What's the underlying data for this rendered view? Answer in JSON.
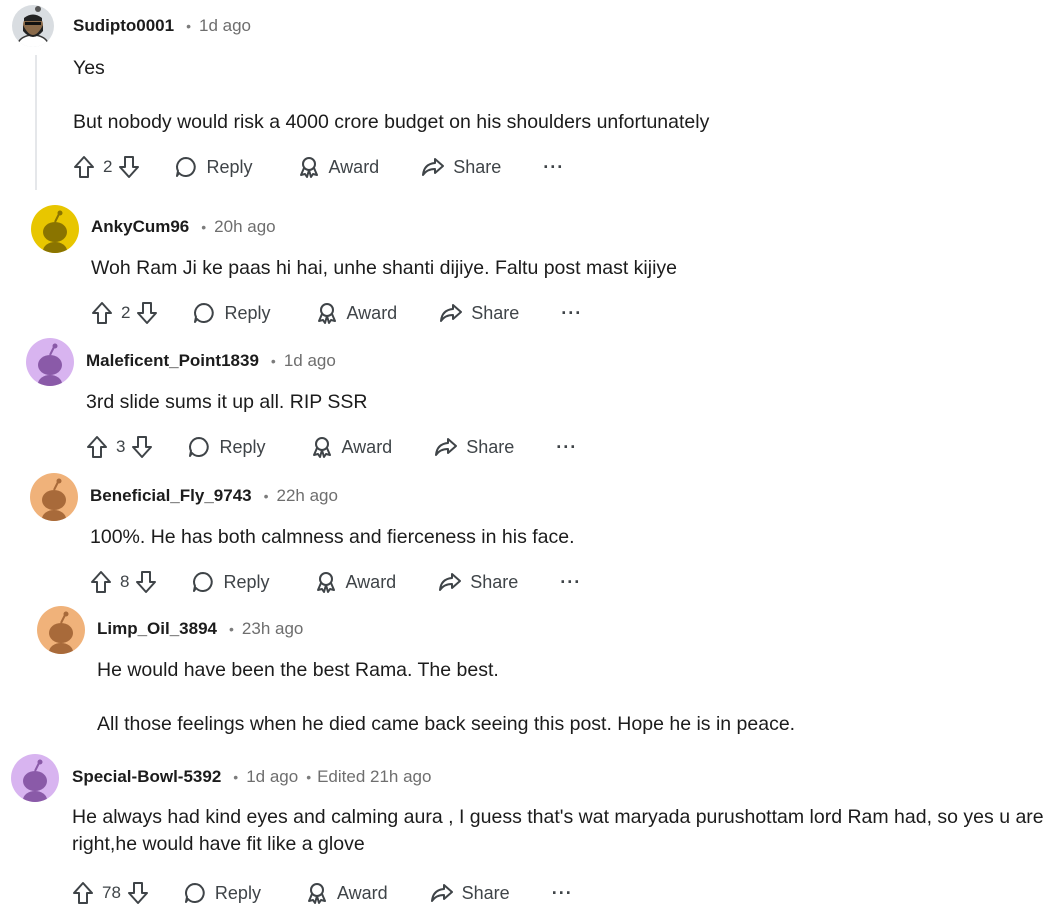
{
  "comments": [
    {
      "author": "Sudipto0001",
      "time": "1d ago",
      "body": [
        "Yes",
        "But nobody would risk a 4000 crore budget on his shoulders unfortunately"
      ],
      "votes": "2",
      "avatar_color": "#d9dde1",
      "avatar_icon": "bearded-man-avatar"
    },
    {
      "author": "AnkyCum96",
      "time": "20h ago",
      "body": [
        "Woh Ram Ji ke paas hi hai, unhe shanti dijiye. Faltu post mast kijiye"
      ],
      "votes": "2",
      "avatar_color": "#e8c600",
      "avatar_icon": "snoo-avatar"
    },
    {
      "author": "Maleficent_Point1839",
      "time": "1d ago",
      "body": [
        "3rd slide sums it up all. RIP SSR"
      ],
      "votes": "3",
      "avatar_color": "#d8b4f0",
      "avatar_icon": "snoo-avatar"
    },
    {
      "author": "Beneficial_Fly_9743",
      "time": "22h ago",
      "body": [
        "100%. He has both calmness and fierceness in his face."
      ],
      "votes": "8",
      "avatar_color": "#f0b27a",
      "avatar_icon": "snoo-avatar"
    },
    {
      "author": "Limp_Oil_3894",
      "time": "23h ago",
      "body": [
        "He would have been the best Rama. The best.",
        "All those feelings when he died came back seeing this post. Hope he is in peace."
      ],
      "avatar_color": "#f0b27a",
      "avatar_icon": "snoo-avatar"
    },
    {
      "author": "Special-Bowl-5392",
      "time": "1d ago",
      "edited": "Edited 21h ago",
      "body": [
        "He always had kind eyes and calming aura , I guess that's wat maryada purushottam lord Ram had, so yes u are right,he would have fit like a glove"
      ],
      "votes": "78",
      "avatar_color": "#d8b4f0",
      "avatar_icon": "snoo-avatar"
    }
  ],
  "actions": {
    "reply": "Reply",
    "award": "Award",
    "share": "Share",
    "more": "···"
  }
}
